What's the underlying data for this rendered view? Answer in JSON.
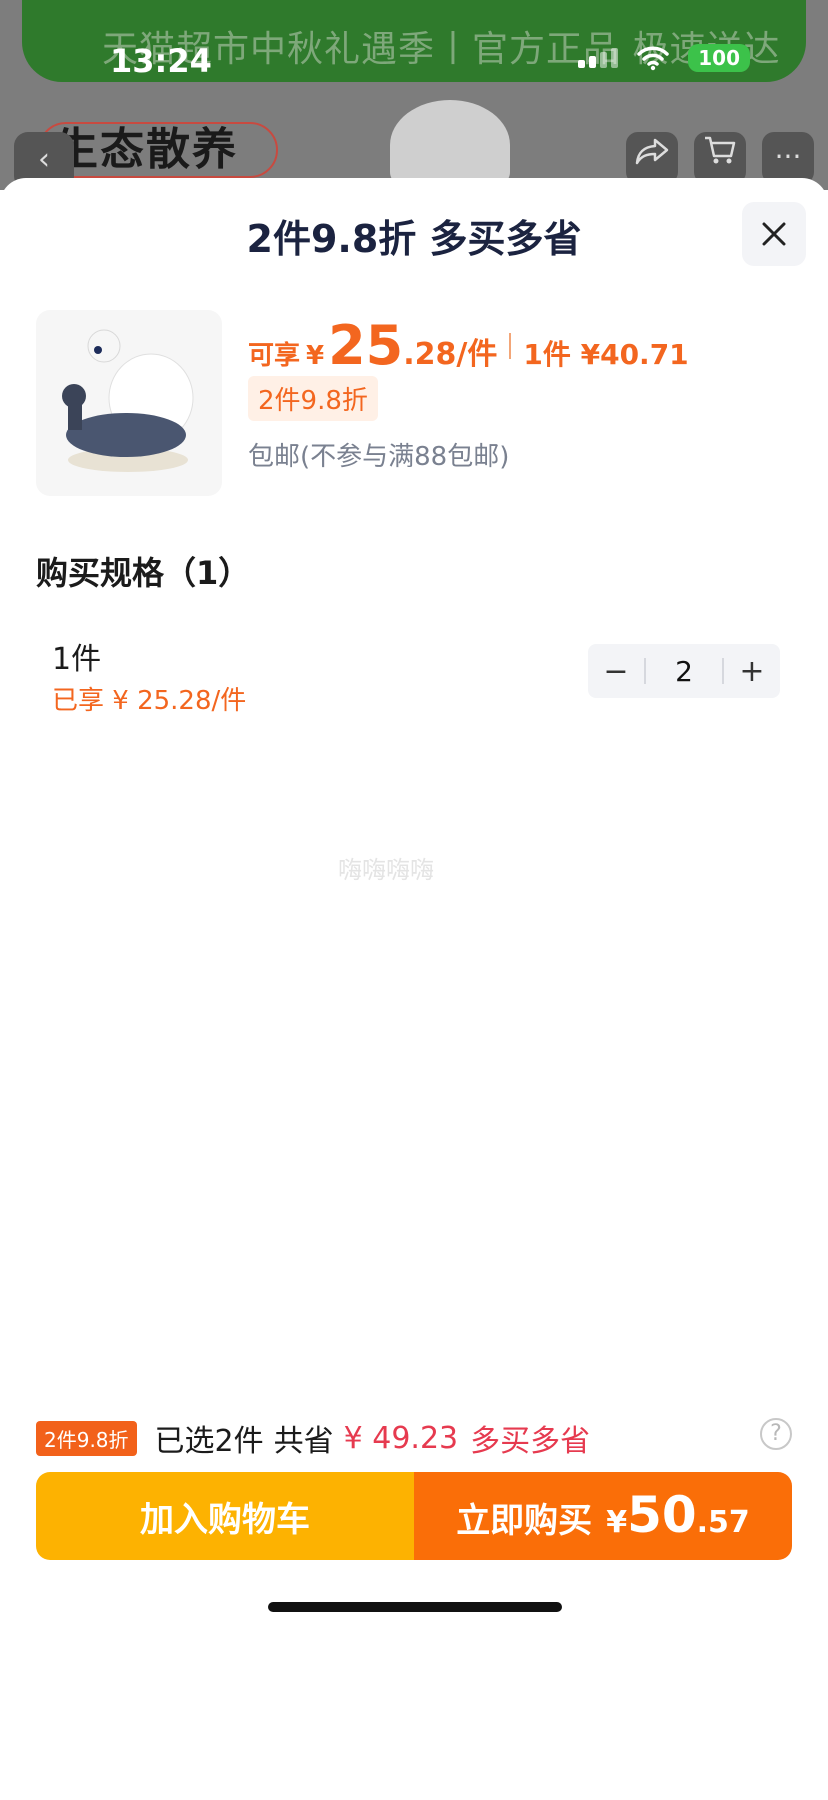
{
  "status": {
    "time": "13:24",
    "battery": "100"
  },
  "background": {
    "banner": "天猫超市中秋礼遇季丨官方正品 极速送达",
    "tag": "生态散养"
  },
  "sheet": {
    "title": "2件9.8折 多买多省",
    "product": {
      "price_label": "可享",
      "currency": "¥",
      "price_int": "25",
      "price_dec": ".28/件",
      "single_price": "1件 ¥40.71",
      "discount_tag": "2件9.8折",
      "shipping": "包邮(不参与满88包邮)"
    },
    "spec": {
      "title": "购买规格（1）",
      "item_name": "1件",
      "item_price": "已享 ¥ 25.28/件",
      "quantity": "2",
      "minus": "−",
      "plus": "+"
    },
    "watermark": "嗨嗨嗨嗨"
  },
  "footer": {
    "badge": "2件9.8折",
    "selected": "已选2件",
    "save_label": "共省",
    "save_amount": "¥ 49.23",
    "more": "多买多省",
    "help": "?",
    "add_cart": "加入购物车",
    "buy_now": "立即购买",
    "buy_yen": "¥",
    "buy_int": "50",
    "buy_dec": ".57"
  },
  "colors": {
    "accent": "#f3661f",
    "cart_button": "#fdb201",
    "buy_button": "#fa6e08",
    "save_red": "#e63a4f"
  },
  "icons": {
    "close": "close-icon",
    "back": "back-icon",
    "share": "share-icon",
    "cart": "cart-icon",
    "more": "more-icon",
    "help": "help-icon",
    "wifi": "wifi-icon"
  }
}
